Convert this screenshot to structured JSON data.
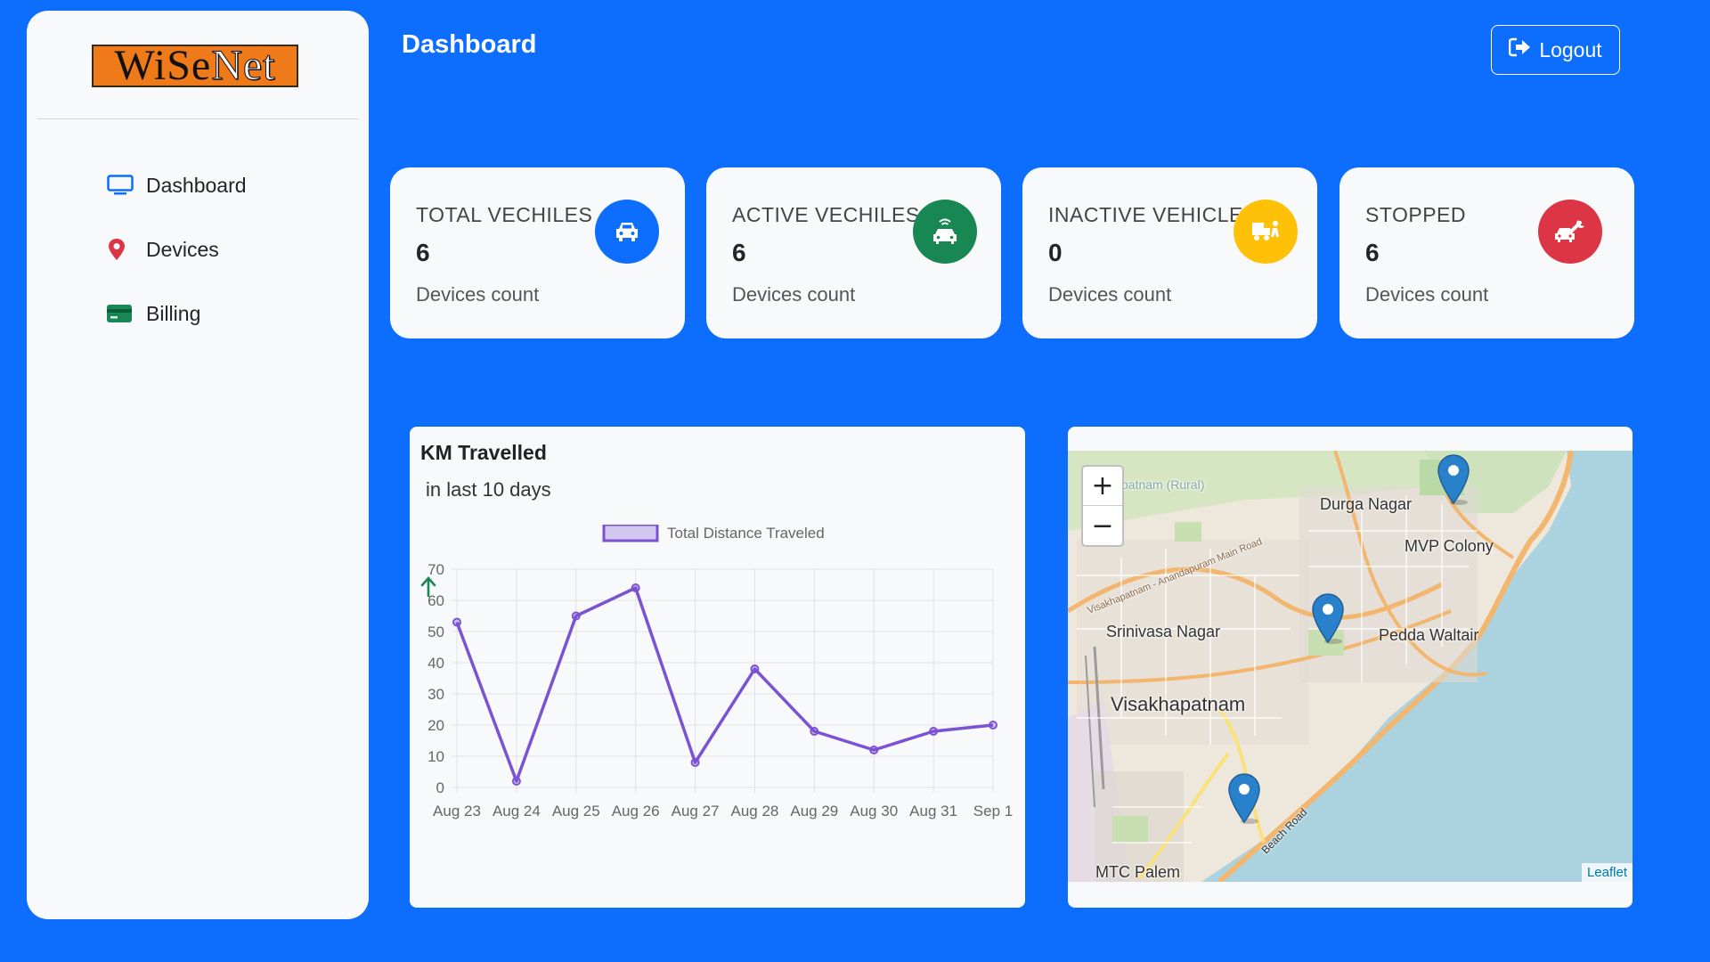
{
  "sidebar": {
    "logo": "WiSeNet",
    "items": [
      {
        "label": "Dashboard",
        "icon": "monitor-icon"
      },
      {
        "label": "Devices",
        "icon": "map-pin-icon"
      },
      {
        "label": "Billing",
        "icon": "credit-card-icon"
      }
    ]
  },
  "header": {
    "title": "Dashboard",
    "logout_label": "Logout"
  },
  "cards": [
    {
      "title": "TOTAL VECHILES",
      "count": "6",
      "sub": "Devices count",
      "color": "#0d6efd",
      "icon": "car-icon"
    },
    {
      "title": "ACTIVE VECHILES",
      "count": "6",
      "sub": "Devices count",
      "color": "#198754",
      "icon": "connected-car-icon"
    },
    {
      "title": "INACTIVE VEHICLES",
      "count": "0",
      "sub": "Devices count",
      "color": "#ffc107",
      "icon": "truck-loading-icon"
    },
    {
      "title": "STOPPED",
      "count": "6",
      "sub": "Devices count",
      "color": "#dc3545",
      "icon": "car-wrench-icon"
    }
  ],
  "chart_panel": {
    "title": "KM Travelled",
    "subtitle": "in last 10 days"
  },
  "chart_data": {
    "type": "line",
    "categories": [
      "Aug 23",
      "Aug 24",
      "Aug 25",
      "Aug 26",
      "Aug 27",
      "Aug 28",
      "Aug 29",
      "Aug 30",
      "Aug 31",
      "Sep 1"
    ],
    "series": [
      {
        "name": "Total Distance Traveled",
        "values": [
          53,
          2,
          55,
          64,
          8,
          38,
          18,
          12,
          18,
          20
        ],
        "color": "#7b52d4"
      }
    ],
    "yticks": [
      0,
      10,
      20,
      30,
      40,
      50,
      60,
      70
    ],
    "ylim": [
      0,
      70
    ],
    "grid": true,
    "legend": "top"
  },
  "map": {
    "labels": [
      "Durga Nagar",
      "MVP Colony",
      "Srinivasa Nagar",
      "Pedda Waltair",
      "Visakhapatnam",
      "MTC Palem",
      "Beach Road",
      "patnam (Rural)",
      "Visakhapatnam - Anandapuram Main Road"
    ],
    "zoom_in": "+",
    "zoom_out": "−",
    "attribution": "Leaflet",
    "markers": 3
  }
}
